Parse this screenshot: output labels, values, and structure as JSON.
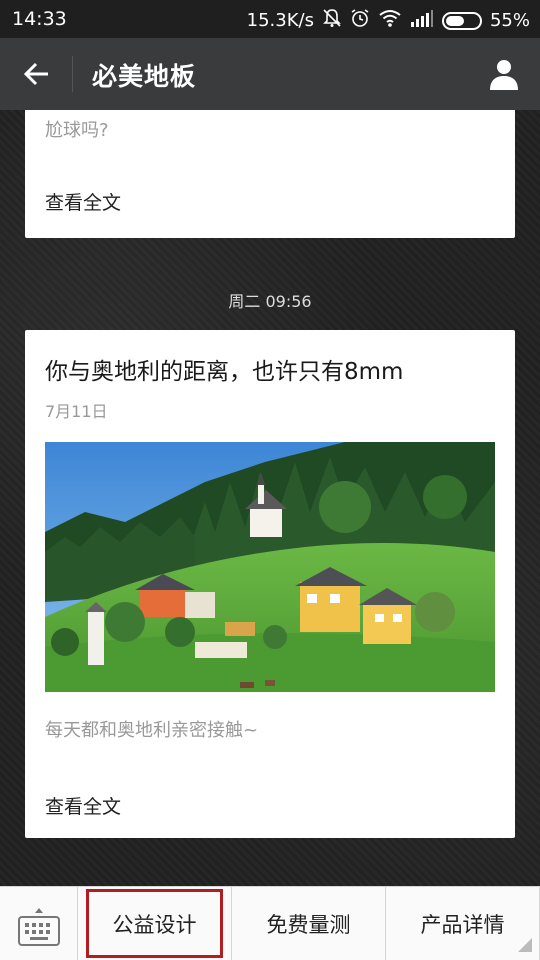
{
  "status_bar": {
    "time": "14:33",
    "network_speed": "15.3K/s",
    "battery": "55%",
    "battery_level": 0.55,
    "icons": [
      "mute-bell-icon",
      "alarm-icon",
      "wifi-icon",
      "signal-icon",
      "battery-icon"
    ]
  },
  "header": {
    "title": "必美地板",
    "back_icon": "arrow-left-icon",
    "profile_icon": "person-icon"
  },
  "messages": {
    "card1": {
      "excerpt": "尬球吗?",
      "read_more": "查看全文"
    },
    "timestamp": "周二 09:56",
    "card2": {
      "title": "你与奥地利的距离，也许只有8mm",
      "date": "7月11日",
      "description": "每天都和奥地利亲密接触~",
      "read_more": "查看全文"
    }
  },
  "bottom_menu": {
    "keyboard_icon": "keyboard-icon",
    "items": [
      {
        "label": "公益设计",
        "highlighted": true
      },
      {
        "label": "免费量测",
        "highlighted": false
      },
      {
        "label": "产品详情",
        "highlighted": false
      }
    ]
  },
  "colors": {
    "header_bg": "#3a3b3d",
    "highlight_border": "#b21d22",
    "sky": "#4a90d9",
    "grass": "#5aa33a"
  }
}
